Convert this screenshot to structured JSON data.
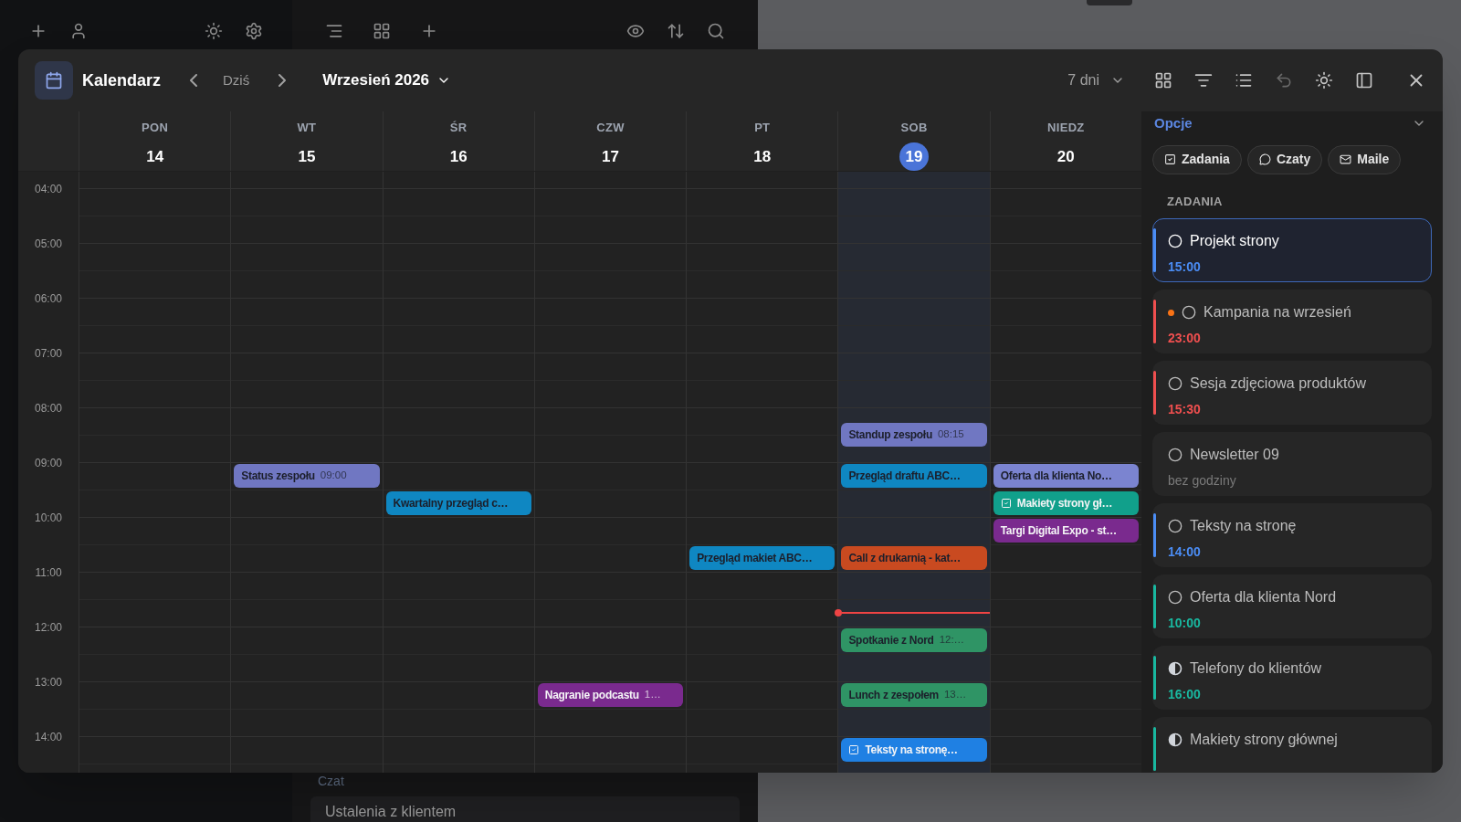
{
  "background": {
    "section_label": "Czat",
    "item": "Ustalenia z klientem"
  },
  "calendar": {
    "title": "Kalendarz",
    "today": "Dziś",
    "month": "Wrzesień 2026",
    "range": "7 dni"
  },
  "hours": [
    "04:00",
    "05:00",
    "06:00",
    "07:00",
    "08:00",
    "09:00",
    "10:00",
    "11:00",
    "12:00",
    "13:00",
    "14:00"
  ],
  "days": [
    {
      "name": "PON",
      "number": "14",
      "selected": false,
      "cells": [
        {
          "now_line": false
        },
        {
          "now_line": false
        },
        {
          "now_line": false
        },
        {
          "now_line": false
        },
        {
          "now_line": false
        },
        {
          "now_line": false
        },
        {
          "now_line": false
        },
        {
          "now_line": false
        },
        {
          "now_line": false
        },
        {
          "now_line": false
        },
        {
          "now_line": false
        }
      ]
    },
    {
      "name": "WT",
      "number": "15",
      "selected": false,
      "cells": [
        {
          "now_line": false
        },
        {
          "now_line": false
        },
        {
          "now_line": false
        },
        {
          "now_line": false
        },
        {
          "now_line": false
        },
        {
          "now_line": false,
          "on_hour": [
            {
              "title": "Status zespołu",
              "time": "09:00",
              "kind": "event",
              "color": "#7077c2"
            }
          ]
        },
        {
          "now_line": false
        },
        {
          "now_line": false
        },
        {
          "now_line": false
        },
        {
          "now_line": false
        },
        {
          "now_line": false
        }
      ]
    },
    {
      "name": "ŚR",
      "number": "16",
      "selected": false,
      "cells": [
        {
          "now_line": false
        },
        {
          "now_line": false
        },
        {
          "now_line": false
        },
        {
          "now_line": false
        },
        {
          "now_line": false
        },
        {
          "now_line": false,
          "half_past": [
            {
              "title": "Kwartalny przegląd c…",
              "kind": "event",
              "color": "#0f87c2"
            }
          ]
        },
        {
          "now_line": false
        },
        {
          "now_line": false
        },
        {
          "now_line": false
        },
        {
          "now_line": false
        },
        {
          "now_line": false
        }
      ]
    },
    {
      "name": "CZW",
      "number": "17",
      "selected": false,
      "cells": [
        {
          "now_line": false
        },
        {
          "now_line": false
        },
        {
          "now_line": false
        },
        {
          "now_line": false
        },
        {
          "now_line": false
        },
        {
          "now_line": false
        },
        {
          "now_line": false
        },
        {
          "now_line": false
        },
        {
          "now_line": false
        },
        {
          "now_line": false,
          "on_hour": [
            {
              "title": "Nagranie podcastu",
              "time": "1…",
              "kind": "event",
              "color": "#7a2a8e"
            }
          ]
        },
        {
          "now_line": false
        }
      ]
    },
    {
      "name": "PT",
      "number": "18",
      "selected": false,
      "cells": [
        {
          "now_line": false
        },
        {
          "now_line": false
        },
        {
          "now_line": false
        },
        {
          "now_line": false
        },
        {
          "now_line": false
        },
        {
          "now_line": false
        },
        {
          "now_line": false,
          "half_past": [
            {
              "title": "Przegląd makiet ABC…",
              "kind": "event",
              "color": "#0f87c2"
            }
          ]
        },
        {
          "now_line": false
        },
        {
          "now_line": false
        },
        {
          "now_line": false
        },
        {
          "now_line": false
        }
      ]
    },
    {
      "name": "SOB",
      "number": "19",
      "selected": true,
      "cells": [
        {
          "now_line": false
        },
        {
          "now_line": false
        },
        {
          "now_line": false
        },
        {
          "now_line": false
        },
        {
          "now_line": false,
          "quarter_past": [
            {
              "title": "Standup zespołu",
              "time": "08:15",
              "kind": "event",
              "color": "#7077c2"
            }
          ]
        },
        {
          "now_line": false,
          "on_hour": [
            {
              "title": "Przegląd draftu ABC…",
              "kind": "event",
              "color": "#0f87c2"
            }
          ]
        },
        {
          "now_line": false,
          "half_past": [
            {
              "title": "Call z drukarnią - kat…",
              "kind": "event",
              "color": "#c94a20"
            }
          ]
        },
        {
          "now_line": true
        },
        {
          "now_line": false,
          "on_hour": [
            {
              "title": "Spotkanie z Nord",
              "time": "12:…",
              "kind": "event",
              "color": "#2f9465"
            }
          ]
        },
        {
          "now_line": false,
          "on_hour": [
            {
              "title": "Lunch z zespołem",
              "time": "13…",
              "kind": "event",
              "color": "#2f9465"
            }
          ]
        },
        {
          "now_line": false,
          "on_hour": [
            {
              "title": "Teksty na stronę…",
              "kind": "task",
              "color": "#1f80e3"
            }
          ]
        }
      ]
    },
    {
      "name": "NIEDZ",
      "number": "20",
      "selected": false,
      "cells": [
        {
          "now_line": false
        },
        {
          "now_line": false
        },
        {
          "now_line": false
        },
        {
          "now_line": false
        },
        {
          "now_line": false
        },
        {
          "now_line": false,
          "on_hour": [
            {
              "title": "Oferta dla klienta No…",
              "kind": "event",
              "color": "#7b84d0"
            }
          ],
          "half_past": [
            {
              "title": "Makiety strony gł…",
              "kind": "task",
              "color": "#11a08b"
            }
          ]
        },
        {
          "now_line": false,
          "on_hour": [
            {
              "title": "Targi Digital Expo - st…",
              "kind": "event",
              "color": "#7a2a8e"
            }
          ]
        },
        {
          "now_line": false
        },
        {
          "now_line": false
        },
        {
          "now_line": false
        },
        {
          "now_line": false
        }
      ]
    }
  ],
  "sidebar": {
    "title": "Opcje",
    "filters": [
      {
        "label": "Zadania",
        "kind": "tasks"
      },
      {
        "label": "Czaty",
        "kind": "chats"
      },
      {
        "label": "Maile",
        "kind": "mail"
      }
    ],
    "section": "ZADANIA",
    "tasks": [
      {
        "title": "Projekt strony",
        "time": "15:00",
        "color": "#4b8df5",
        "kind": "open",
        "selected": true,
        "flagged": false
      },
      {
        "title": "Kampania na wrzesień",
        "time": "23:00",
        "color": "#ef4f4f",
        "kind": "open",
        "selected": false,
        "flagged": true
      },
      {
        "title": "Sesja zdjęciowa produktów",
        "time": "15:30",
        "color": "#ef4f4f",
        "kind": "open",
        "selected": false,
        "flagged": false
      },
      {
        "title": "Newsletter 09",
        "time": "bez godziny",
        "kind": "open",
        "selected": false,
        "flagged": false
      },
      {
        "title": "Teksty na stronę",
        "time": "14:00",
        "color": "#4b8df5",
        "kind": "open",
        "selected": false,
        "flagged": false
      },
      {
        "title": "Oferta dla klienta Nord",
        "time": "10:00",
        "color": "#19b8a0",
        "kind": "open",
        "selected": false,
        "flagged": false
      },
      {
        "title": "Telefony do klientów",
        "time": "16:00",
        "color": "#19b8a0",
        "kind": "partial",
        "selected": false,
        "flagged": false
      },
      {
        "title": "Makiety strony głównej",
        "color": "#19b8a0",
        "kind": "partial",
        "selected": false,
        "flagged": false
      }
    ]
  }
}
